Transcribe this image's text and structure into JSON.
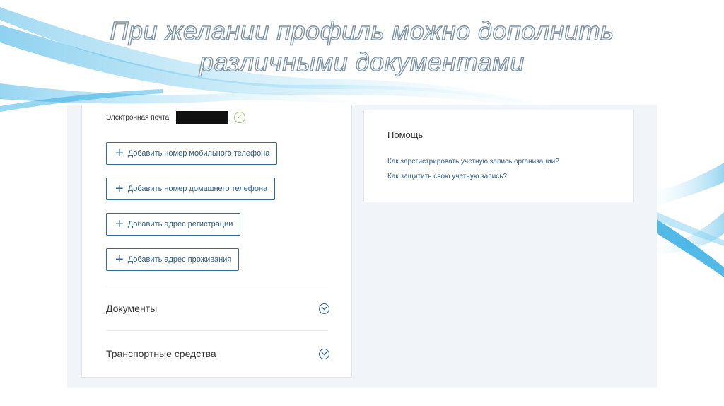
{
  "slide": {
    "title_line1": "При желании профиль можно дополнить",
    "title_line2": "различными документами"
  },
  "profile": {
    "email_label": "Электронная почта",
    "add_buttons": [
      "Добавить номер мобильного телефона",
      "Добавить номер домашнего телефона",
      "Добавить адрес регистрации",
      "Добавить адрес проживания"
    ],
    "sections": [
      "Документы",
      "Транспортные средства"
    ]
  },
  "help": {
    "title": "Помощь",
    "links": [
      "Как зарегистрировать учетную запись организации?",
      "Как защитить свою учетную запись?"
    ]
  },
  "colors": {
    "accent": "#2f6a96",
    "swoosh": "#29a9e0",
    "check": "#8fbd55"
  },
  "icons": [
    "plus-icon",
    "check-icon",
    "chevron-down-icon"
  ]
}
